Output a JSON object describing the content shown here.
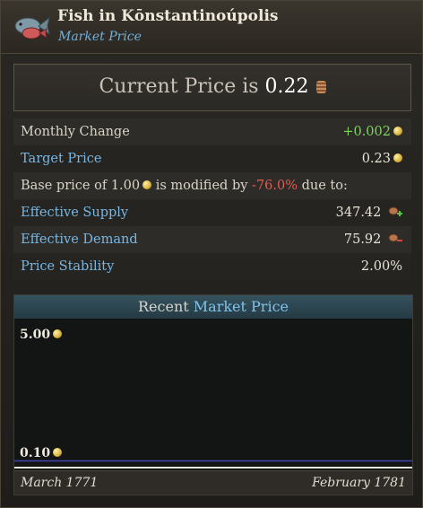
{
  "header": {
    "title": "Fish in Kōnstantinoúpolis",
    "subtitle": "Market Price",
    "icon": "fish-icon"
  },
  "price": {
    "label": "Current Price is",
    "value": "0.22"
  },
  "stats": {
    "monthly_change_label": "Monthly Change",
    "monthly_change_value": "+0.002",
    "target_price_label": "Target Price",
    "target_price_value": "0.23",
    "base_prefix": "Base price of",
    "base_value": "1.00",
    "base_mid": "is modified by",
    "base_modifier": "-76.0%",
    "base_suffix": "due to:",
    "effective_supply_label": "Effective Supply",
    "effective_supply_value": "347.42",
    "effective_demand_label": "Effective Demand",
    "effective_demand_value": "75.92",
    "price_stability_label": "Price Stability",
    "price_stability_value": "2.00%"
  },
  "colors": {
    "accent_blue": "#77b7e4",
    "positive": "#7ed35f",
    "negative": "#e25b52",
    "series": "#3b48a8"
  },
  "chart_data": {
    "type": "line",
    "title_prefix": "Recent",
    "title_highlight": "Market Price",
    "x_start": "March 1771",
    "x_end": "February 1781",
    "ylim": [
      0.1,
      5.0
    ],
    "y_max_label": "5.00",
    "y_min_label": "0.10",
    "series": [
      {
        "values": [
          0.22,
          0.22
        ]
      }
    ]
  }
}
